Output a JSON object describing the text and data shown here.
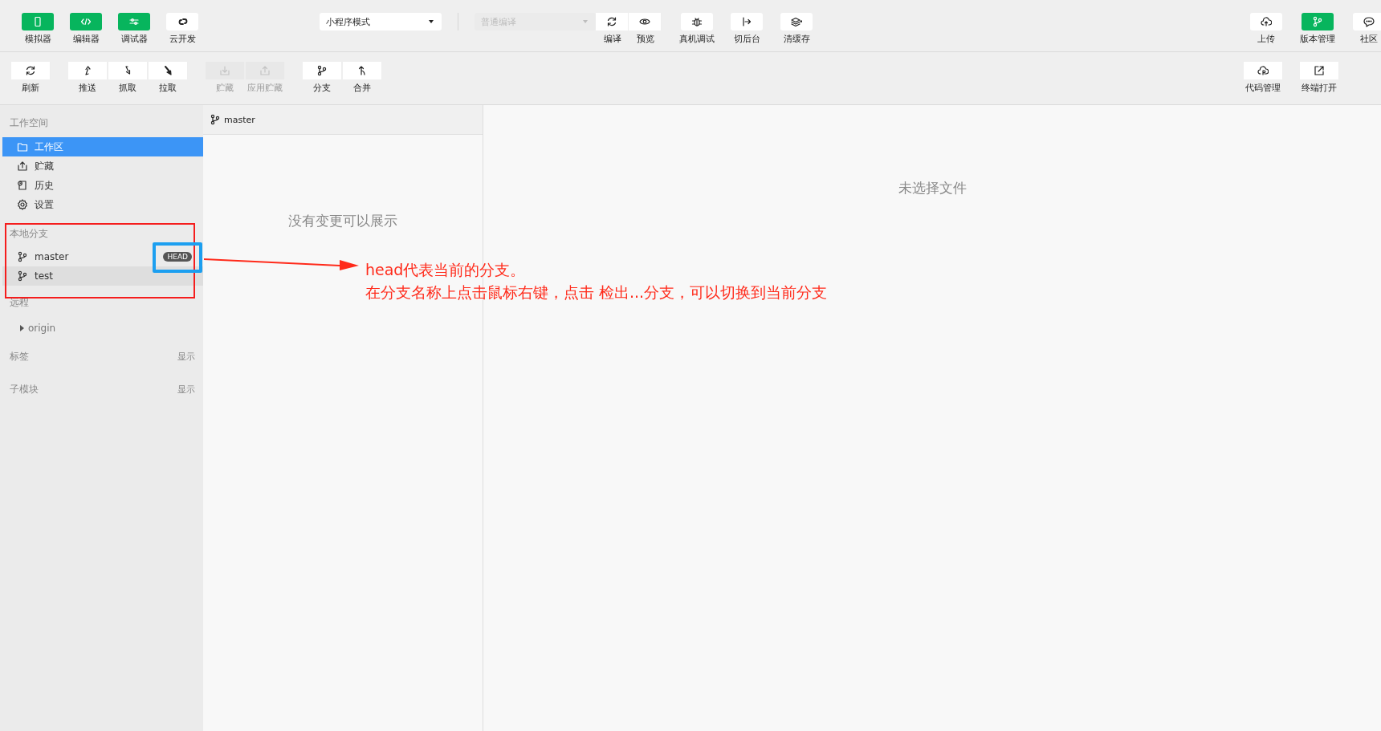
{
  "top_toolbar": {
    "view_toggles": [
      {
        "label": "模拟器",
        "selected": true
      },
      {
        "label": "编辑器",
        "selected": true
      },
      {
        "label": "调试器",
        "selected": true
      },
      {
        "label": "云开发",
        "selected": false
      }
    ],
    "mode_select": {
      "value": "小程序模式"
    },
    "compile_select": {
      "value": "普通编译",
      "disabled": true
    },
    "compile_actions": [
      {
        "label": "编译"
      },
      {
        "label": "预览"
      }
    ],
    "actions": [
      {
        "label": "真机调试"
      },
      {
        "label": "切后台"
      },
      {
        "label": "清缓存"
      }
    ],
    "right_actions": [
      {
        "label": "上传",
        "selected": false
      },
      {
        "label": "版本管理",
        "selected": true
      },
      {
        "label": "社区",
        "selected": false
      }
    ]
  },
  "git_toolbar": {
    "groups": [
      [
        {
          "label": "刷新",
          "disabled": false
        }
      ],
      [
        {
          "label": "推送",
          "disabled": false
        },
        {
          "label": "抓取",
          "disabled": false
        },
        {
          "label": "拉取",
          "disabled": false
        }
      ],
      [
        {
          "label": "贮藏",
          "disabled": true
        },
        {
          "label": "应用贮藏",
          "disabled": true
        }
      ],
      [
        {
          "label": "分支",
          "disabled": false
        },
        {
          "label": "合并",
          "disabled": false
        }
      ]
    ],
    "right_actions": [
      {
        "label": "代码管理"
      },
      {
        "label": "终端打开"
      }
    ]
  },
  "sidebar": {
    "workspace": {
      "title": "工作空间",
      "items": [
        {
          "label": "工作区",
          "selected": true
        },
        {
          "label": "贮藏",
          "selected": false
        },
        {
          "label": "历史",
          "selected": false
        },
        {
          "label": "设置",
          "selected": false
        }
      ]
    },
    "local_branches": {
      "title": "本地分支",
      "head_label": "HEAD",
      "items": [
        {
          "name": "master",
          "head": true,
          "highlighted": false
        },
        {
          "name": "test",
          "head": false,
          "highlighted": true
        }
      ]
    },
    "remote": {
      "title": "远程",
      "items": [
        {
          "name": "origin",
          "expanded": false
        }
      ]
    },
    "tags": {
      "title": "标签",
      "action": "显示"
    },
    "submodules": {
      "title": "子模块",
      "action": "显示"
    }
  },
  "changes_panel": {
    "branch": "master",
    "empty_text": "没有变更可以展示"
  },
  "detail_panel": {
    "empty_text": "未选择文件"
  },
  "annotation": {
    "lines": [
      "head代表当前的分支。",
      "在分支名称上点击鼠标右键，点击  检出...分支，可以切换到当前分支"
    ]
  }
}
